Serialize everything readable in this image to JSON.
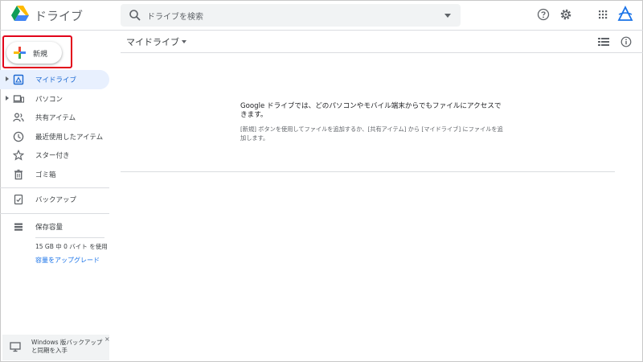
{
  "app": {
    "title": "ドライブ"
  },
  "search": {
    "placeholder": "ドライブを検索"
  },
  "new_button": {
    "label": "新規"
  },
  "sidebar": {
    "items": [
      {
        "label": "マイドライブ",
        "icon": "my-drive-icon",
        "active": true,
        "expandable": true
      },
      {
        "label": "パソコン",
        "icon": "computers-icon",
        "active": false,
        "expandable": true
      },
      {
        "label": "共有アイテム",
        "icon": "shared-icon",
        "active": false,
        "expandable": false
      },
      {
        "label": "最近使用したアイテム",
        "icon": "clock-icon",
        "active": false,
        "expandable": false
      },
      {
        "label": "スター付き",
        "icon": "star-icon",
        "active": false,
        "expandable": false
      },
      {
        "label": "ゴミ箱",
        "icon": "trash-icon",
        "active": false,
        "expandable": false
      }
    ],
    "backup": {
      "label": "バックアップ",
      "icon": "backup-icon"
    },
    "storage": {
      "label": "保存容量",
      "icon": "storage-icon",
      "used": "15 GB 中 0 バイト を使用",
      "upgrade": "容量をアップグレード"
    }
  },
  "promo": {
    "text": "Windows 版バックアップと同期を入手",
    "close": "×"
  },
  "main": {
    "title": "マイドライブ",
    "empty_main": "Google ドライブでは、どのパソコンやモバイル端末からでもファイルにアクセスできます。",
    "empty_sub": "[新規] ボタンを使用してファイルを追加するか、[共有アイテム] から [マイドライブ] にファイルを追加します。"
  },
  "colors": {
    "accent": "#1a73e8",
    "active_bg": "#e8f0fe",
    "highlight_border": "#e2001a"
  }
}
